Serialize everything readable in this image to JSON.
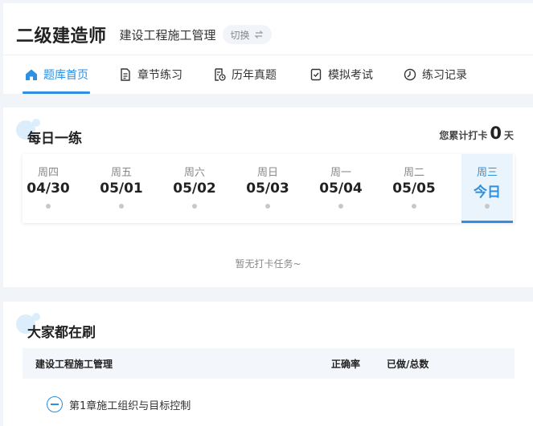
{
  "header": {
    "app_title": "二级建造师",
    "subject": "建设工程施工管理",
    "switch_label": "切换",
    "switch_icon": "swap-icon"
  },
  "nav": {
    "items": [
      {
        "label": "题库首页",
        "icon": "home-icon",
        "active": true
      },
      {
        "label": "章节练习",
        "icon": "document-icon",
        "active": false
      },
      {
        "label": "历年真题",
        "icon": "history-paper-icon",
        "active": false
      },
      {
        "label": "模拟考试",
        "icon": "exam-check-icon",
        "active": false
      },
      {
        "label": "练习记录",
        "icon": "clock-record-icon",
        "active": false
      }
    ]
  },
  "daily": {
    "title": "每日一练",
    "checkin_prefix": "您累计打卡",
    "checkin_count": "0",
    "checkin_unit": "天",
    "days": [
      {
        "weekday": "周四",
        "date": "04/30"
      },
      {
        "weekday": "周五",
        "date": "05/01"
      },
      {
        "weekday": "周六",
        "date": "05/02"
      },
      {
        "weekday": "周日",
        "date": "05/03"
      },
      {
        "weekday": "周一",
        "date": "05/04"
      },
      {
        "weekday": "周二",
        "date": "05/05"
      },
      {
        "weekday": "周三",
        "date": "今日",
        "today": true
      }
    ],
    "empty_note": "暂无打卡任务~"
  },
  "popular": {
    "title": "大家都在刷",
    "columns": [
      "建设工程施工管理",
      "正确率",
      "已做/总数"
    ],
    "chapters": [
      {
        "label": "第1章施工组织与目标控制",
        "expanded": true
      }
    ]
  },
  "colors": {
    "accent": "#2f8fe0",
    "today_bg": "#eaf4fd",
    "page_bg": "#f1f4f8"
  }
}
